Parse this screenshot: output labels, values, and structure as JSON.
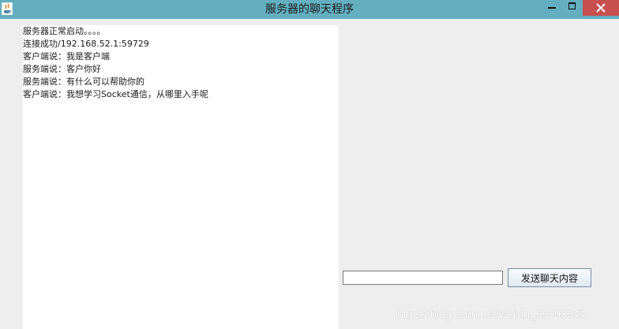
{
  "window": {
    "title": "服务器的聊天程序",
    "titlebar_color": "#63afc0",
    "close_color": "#c7504e"
  },
  "icons": {
    "app": "java-coffee-cup-icon",
    "minimize": "minimize-icon",
    "maximize": "maximize-icon",
    "close": "close-icon"
  },
  "chat": {
    "lines": [
      "服务器正常启动。。。。",
      "连接成功/192.168.52.1:59729",
      "客户端说：我是客户端",
      "服务端说：客户你好",
      "服务端说：有什么可以帮助你的",
      "客户端说：我想学习Socket通信，从哪里入手呢"
    ]
  },
  "input": {
    "value": "",
    "placeholder": ""
  },
  "send_button": {
    "label": "发送聊天内容"
  },
  "watermark": {
    "text": "https://blog.csdn.net/weixin_39593940"
  }
}
